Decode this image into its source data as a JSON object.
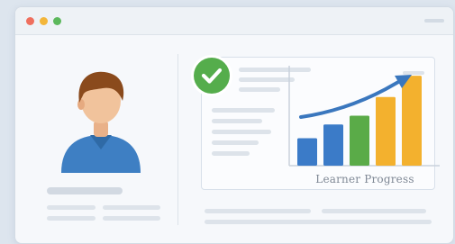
{
  "window": {
    "traffic_lights": [
      "#ef6f5e",
      "#f3b63a",
      "#5cb85c"
    ]
  },
  "profile": {
    "avatar_icon": "user-avatar-icon"
  },
  "status": {
    "icon": "check-circle-icon",
    "color": "#55ad4c"
  },
  "chart_data": {
    "type": "bar",
    "title": "Learner Progress",
    "categories": [
      "",
      "",
      "",
      "",
      ""
    ],
    "values": [
      2.2,
      3.3,
      4.0,
      5.5,
      7.2
    ],
    "colors": [
      "#3b7bc8",
      "#3b7bc8",
      "#5aab48",
      "#f3b12e",
      "#f3b12e"
    ],
    "trend": "up",
    "ylim": [
      0,
      8
    ],
    "xlabel": "",
    "ylabel": ""
  }
}
